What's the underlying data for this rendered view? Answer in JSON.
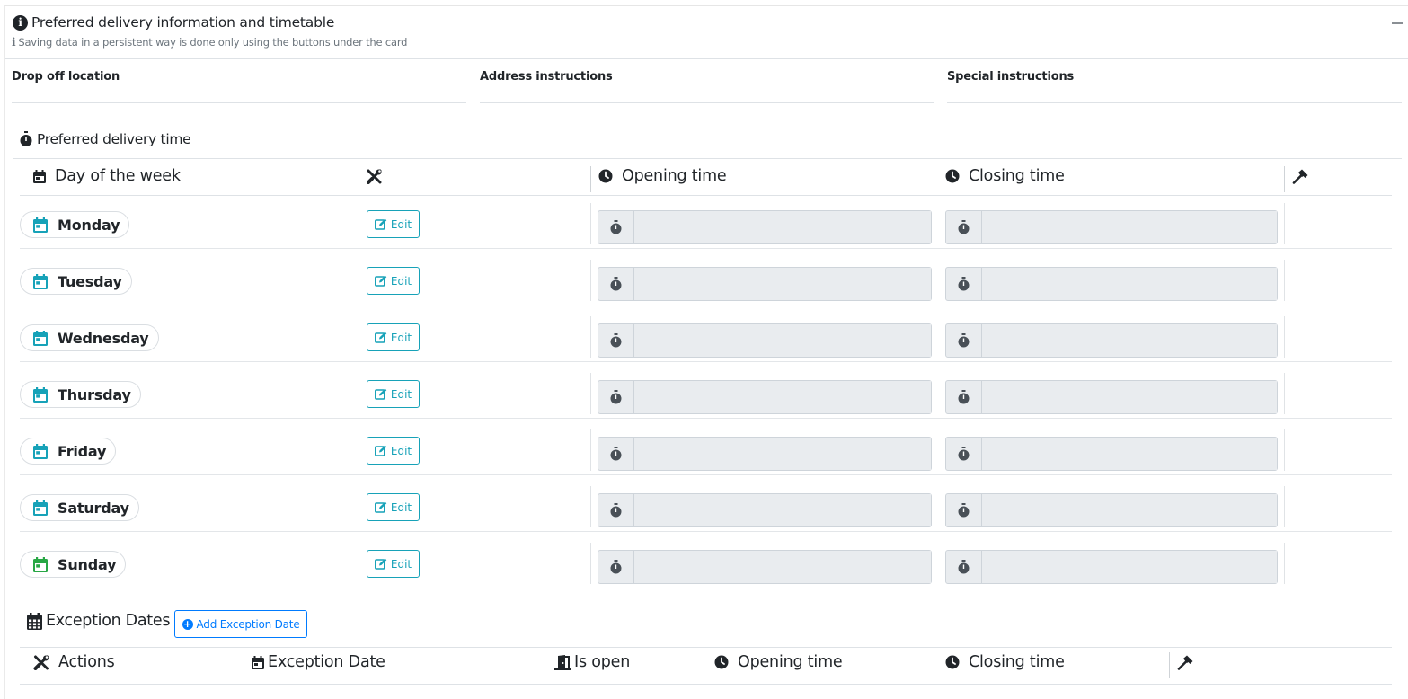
{
  "card": {
    "title": "Preferred delivery information and timetable",
    "subtitle": "Saving data in a persistent way is done only using the buttons under the card"
  },
  "fields": {
    "drop_off": "Drop off location",
    "address": "Address instructions",
    "special": "Special instructions"
  },
  "timetable": {
    "title": "Preferred delivery time",
    "headers": {
      "day": "Day of the week",
      "opening": "Opening time",
      "closing": "Closing time"
    },
    "edit_label": "Edit",
    "days": [
      {
        "name": "Monday",
        "icon_color": "#17a2b8"
      },
      {
        "name": "Tuesday",
        "icon_color": "#17a2b8"
      },
      {
        "name": "Wednesday",
        "icon_color": "#17a2b8"
      },
      {
        "name": "Thursday",
        "icon_color": "#17a2b8"
      },
      {
        "name": "Friday",
        "icon_color": "#17a2b8"
      },
      {
        "name": "Saturday",
        "icon_color": "#17a2b8"
      },
      {
        "name": "Sunday",
        "icon_color": "#28a745"
      }
    ]
  },
  "exceptions": {
    "title": "Exception Dates",
    "add_button": "Add Exception Date",
    "headers": {
      "actions": "Actions",
      "date": "Exception Date",
      "is_open": "Is open",
      "opening": "Opening time",
      "closing": "Closing time"
    }
  },
  "colors": {
    "info": "#17a2b8",
    "success": "#28a745",
    "primary": "#007bff"
  }
}
